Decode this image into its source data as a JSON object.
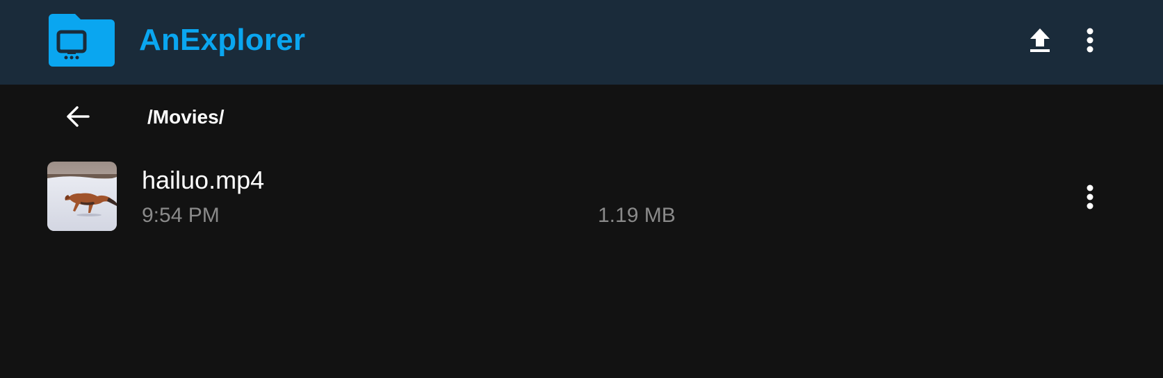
{
  "app": {
    "title": "AnExplorer",
    "accent_color": "#0aa6f0",
    "appbar_color": "#1a2b3a",
    "background_color": "#121212"
  },
  "toolbar": {
    "upload_icon": "upload-icon",
    "menu_icon": "more-vert-icon"
  },
  "path": {
    "back_icon": "arrow-back-icon",
    "current": "/Movies/"
  },
  "files": [
    {
      "name": "hailuo.mp4",
      "time": "9:54 PM",
      "size": "1.19 MB",
      "thumbnail": "video-thumbnail-fox-in-snow",
      "menu_icon": "more-vert-icon"
    }
  ]
}
